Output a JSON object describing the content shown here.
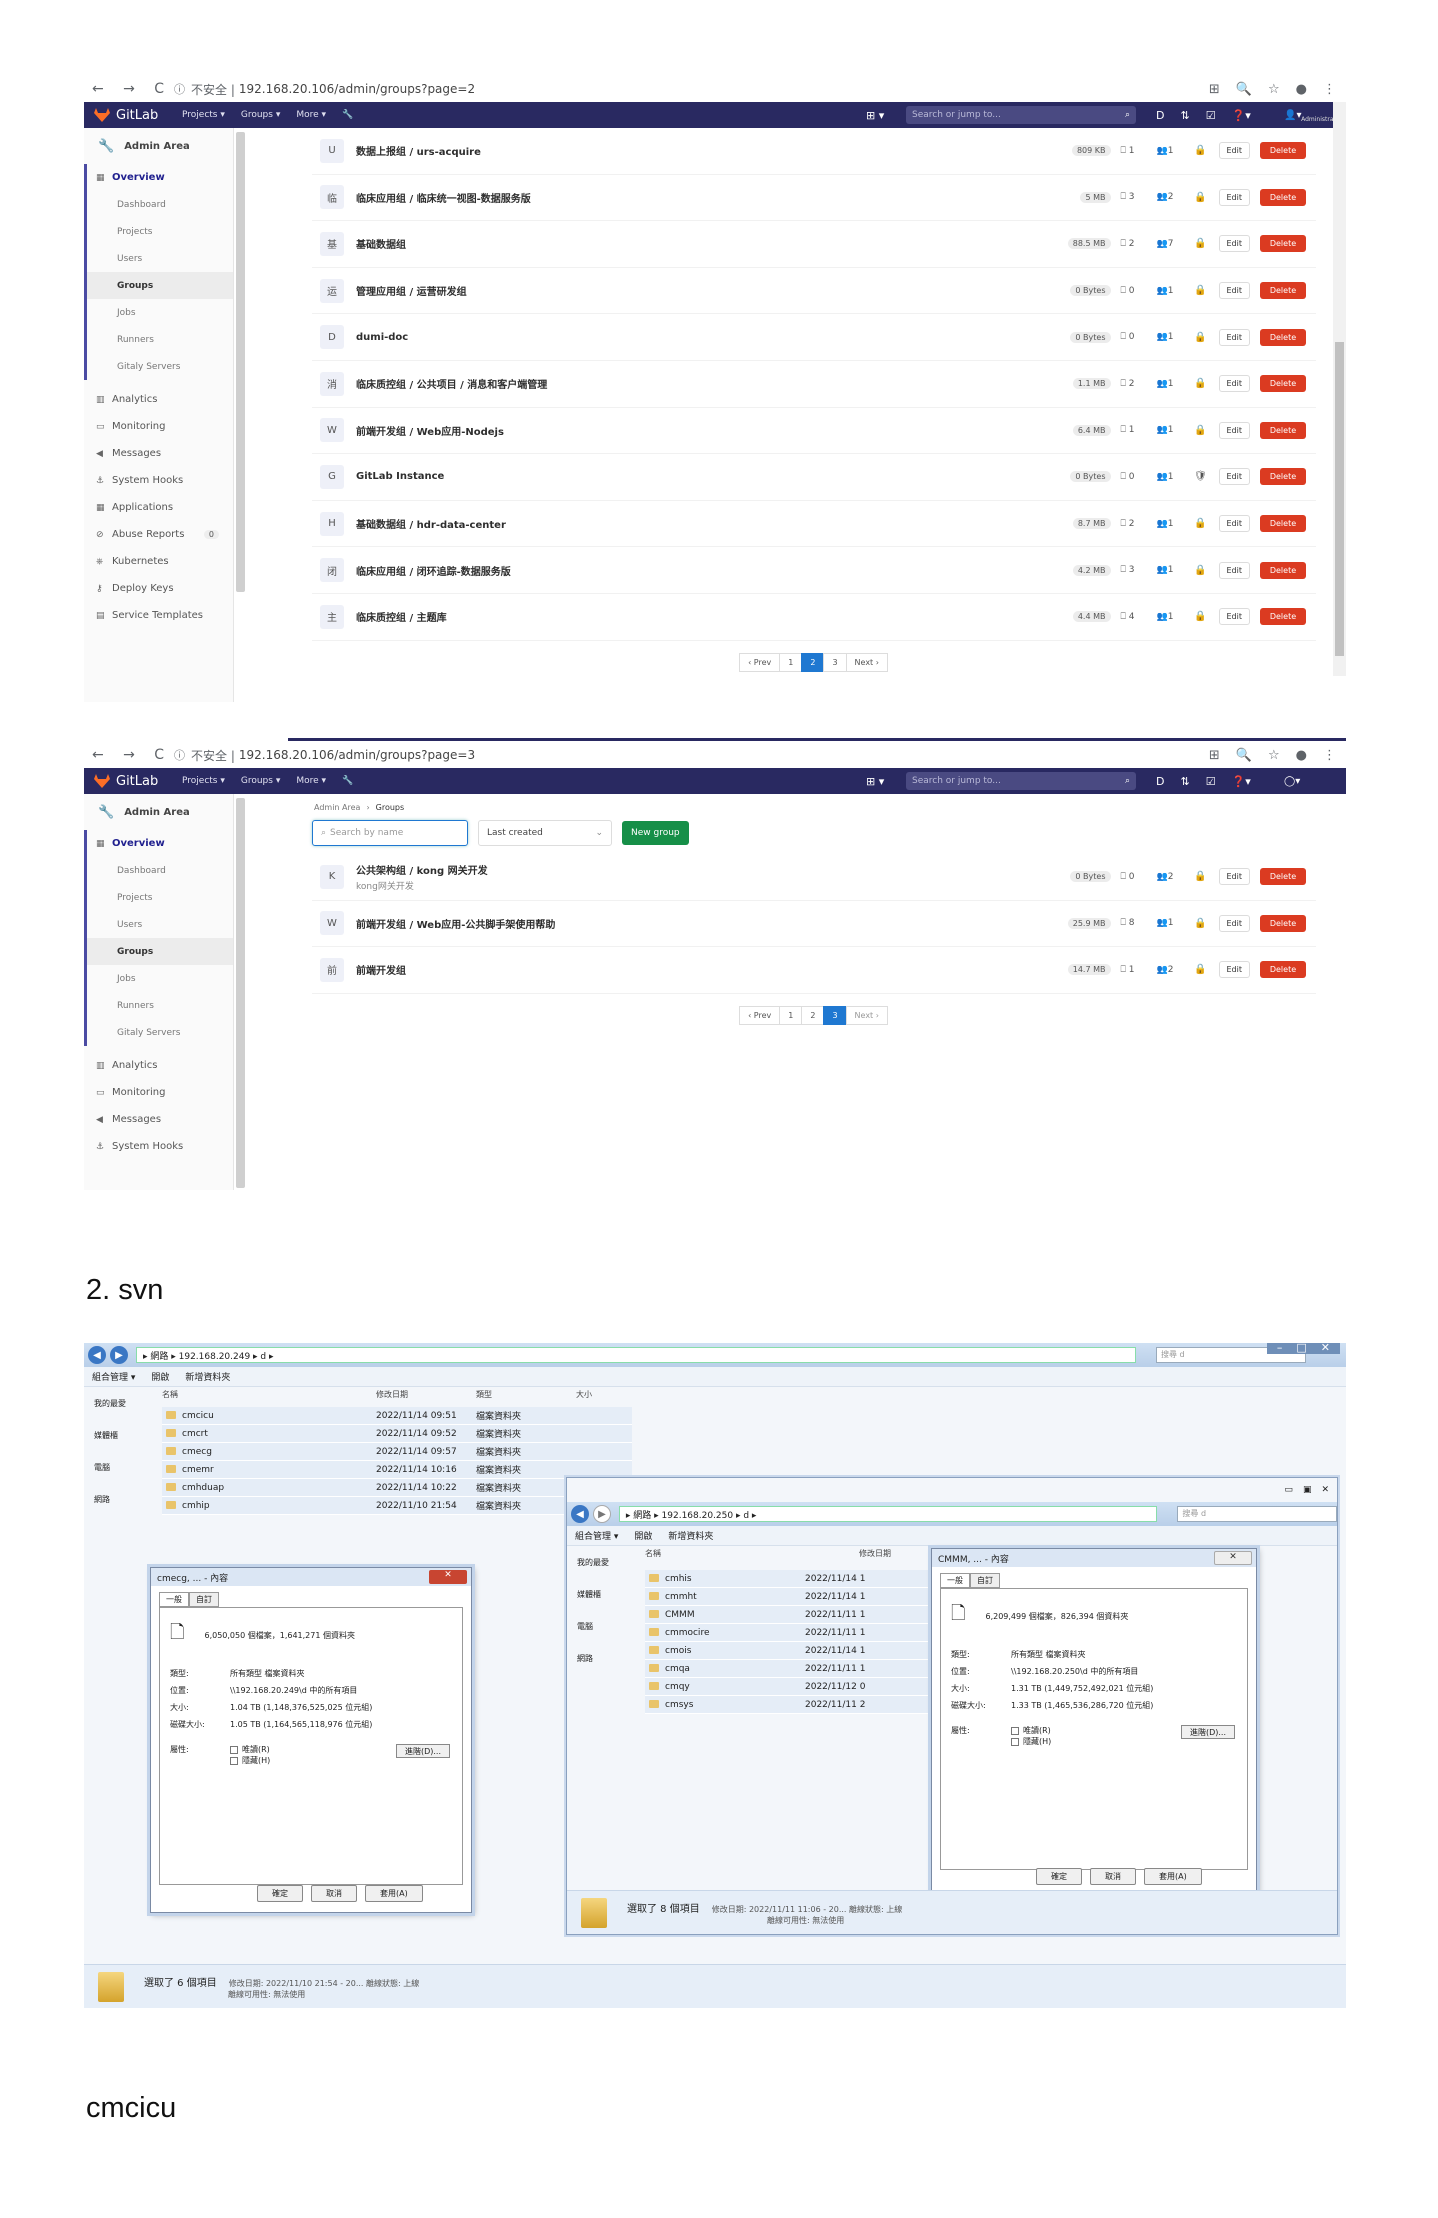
{
  "shot1": {
    "url_prefix": "不安全 | ",
    "url": "192.168.20.106/admin/groups?page=2",
    "topbar": {
      "brand": "GitLab",
      "nav": [
        "Projects ▾",
        "Groups ▾",
        "More ▾"
      ],
      "search_placeholder": "Search or jump to...",
      "user": "Administrator"
    },
    "sidebar": {
      "title": "Admin Area",
      "overview": "Overview",
      "sub": [
        "Dashboard",
        "Projects",
        "Users",
        "Groups",
        "Jobs",
        "Runners",
        "Gitaly Servers"
      ],
      "items": [
        "Analytics",
        "Monitoring",
        "Messages",
        "System Hooks",
        "Applications",
        "Abuse Reports",
        "Kubernetes",
        "Deploy Keys",
        "Service Templates"
      ],
      "abuse_count": "0"
    },
    "rows": [
      {
        "avatar": "U",
        "name": "数据上报组 / urs-acquire",
        "size": "809 KB",
        "projects": "1",
        "members": "1",
        "lock": "🔒"
      },
      {
        "avatar": "临",
        "name": "临床应用组 / 临床统一视图-数据服务版",
        "size": "5 MB",
        "projects": "3",
        "members": "2",
        "lock": "🔒"
      },
      {
        "avatar": "基",
        "name": "基础数据组",
        "size": "88.5 MB",
        "projects": "2",
        "members": "7",
        "lock": "🔒"
      },
      {
        "avatar": "运",
        "name": "管理应用组 / 运营研发组",
        "size": "0 Bytes",
        "projects": "0",
        "members": "1",
        "lock": "🔒"
      },
      {
        "avatar": "D",
        "name": "dumi-doc",
        "size": "0 Bytes",
        "projects": "0",
        "members": "1",
        "lock": "🔒"
      },
      {
        "avatar": "消",
        "name": "临床质控组 / 公共项目 / 消息和客户端管理",
        "size": "1.1 MB",
        "projects": "2",
        "members": "1",
        "lock": "🔒"
      },
      {
        "avatar": "W",
        "name": "前端开发组 / Web应用-Nodejs",
        "size": "6.4 MB",
        "projects": "1",
        "members": "1",
        "lock": "🔒"
      },
      {
        "avatar": "G",
        "name": "GitLab Instance",
        "size": "0 Bytes",
        "projects": "0",
        "members": "1",
        "lock": "🛡"
      },
      {
        "avatar": "H",
        "name": "基础数据组 / hdr-data-center",
        "size": "8.7 MB",
        "projects": "2",
        "members": "1",
        "lock": "🔒"
      },
      {
        "avatar": "闭",
        "name": "临床应用组 / 闭环追踪-数据服务版",
        "size": "4.2 MB",
        "projects": "3",
        "members": "1",
        "lock": "🔒"
      },
      {
        "avatar": "主",
        "name": "临床质控组 / 主题库",
        "size": "4.4 MB",
        "projects": "4",
        "members": "1",
        "lock": "🔒"
      }
    ],
    "edit_label": "Edit",
    "delete_label": "Delete",
    "pager": [
      "‹ Prev",
      "1",
      "2",
      "3",
      "Next ›"
    ],
    "current_page": "2"
  },
  "shot2": {
    "url_prefix": "不安全 | ",
    "url": "192.168.20.106/admin/groups?page=3",
    "breadcrumb": [
      "Admin Area",
      "Groups"
    ],
    "search_placeholder": "Search by name",
    "sort": "Last created",
    "new_group": "New group",
    "sidebar_items": [
      "Analytics",
      "Monitoring",
      "Messages",
      "System Hooks"
    ],
    "rows": [
      {
        "avatar": "K",
        "name": "公共架构组 / kong 网关开发",
        "desc": "kong网关开发",
        "size": "0 Bytes",
        "projects": "0",
        "members": "2",
        "lock": "🔒"
      },
      {
        "avatar": "W",
        "name": "前端开发组 / Web应用-公共脚手架使用帮助",
        "desc": "",
        "size": "25.9 MB",
        "projects": "8",
        "members": "1",
        "lock": "🔒"
      },
      {
        "avatar": "前",
        "name": "前端开发组",
        "desc": "",
        "size": "14.7 MB",
        "projects": "1",
        "members": "2",
        "lock": "🔒"
      }
    ],
    "pager": [
      "‹ Prev",
      "1",
      "2",
      "3",
      "Next ›"
    ],
    "current_page": "3"
  },
  "heading_svn": "2.   svn",
  "heading_cmcicu": "cmcicu",
  "explorer": {
    "path": "▸ 網路 ▸ 192.168.20.249 ▸ d ▸",
    "search": "搜尋 d",
    "toolbar": [
      "組合管理 ▾",
      "開啟",
      "新增資料夾"
    ],
    "nav": [
      "我的最愛",
      "媒體櫃",
      "電腦",
      "網路"
    ],
    "cols": [
      "名稱",
      "修改日期",
      "類型",
      "大小"
    ],
    "files": [
      {
        "name": "cmcicu",
        "date": "2022/11/14 09:51",
        "type": "檔案資料夾"
      },
      {
        "name": "cmcrt",
        "date": "2022/11/14 09:52",
        "type": "檔案資料夾"
      },
      {
        "name": "cmecg",
        "date": "2022/11/14 09:57",
        "type": "檔案資料夾"
      },
      {
        "name": "cmemr",
        "date": "2022/11/14 10:16",
        "type": "檔案資料夾"
      },
      {
        "name": "cmhduap",
        "date": "2022/11/14 10:22",
        "type": "檔案資料夾"
      },
      {
        "name": "cmhip",
        "date": "2022/11/10 21:54",
        "type": "檔案資料夾"
      }
    ],
    "status_main": "選取了 6 個項目",
    "status_sub1": "修改日期: 2022/11/10 21:54 - 20... 離線狀態: 上線",
    "status_sub2": "離線可用性: 無法使用",
    "dlg": {
      "title": "cmecg, ... - 內容",
      "tabs": [
        "一般",
        "自訂"
      ],
      "count": "6,050,050 個檔案，1,641,271 個資料夾",
      "kv": [
        [
          "類型:",
          "所有類型 檔案資料夾"
        ],
        [
          "位置:",
          "\\\\192.168.20.249\\d 中的所有項目"
        ],
        [
          "大小:",
          "1.04 TB (1,148,376,525,025 位元組)"
        ],
        [
          "磁碟大小:",
          "1.05 TB (1,164,565,118,976 位元組)"
        ]
      ],
      "attr": "屬性:",
      "readonly": "唯讀(R)",
      "hidden": "隱藏(H)",
      "adv": "進階(D)...",
      "buttons": [
        "確定",
        "取消",
        "套用(A)"
      ]
    }
  },
  "explorer2": {
    "path": "▸ 網路 ▸ 192.168.20.250 ▸ d ▸",
    "search": "搜尋 d",
    "toolbar": [
      "組合管理 ▾",
      "開啟",
      "新增資料夾"
    ],
    "nav": [
      "我的最愛",
      "媒體櫃",
      "電腦",
      "網路"
    ],
    "cols": [
      "名稱",
      "修改日期",
      "類型",
      "大小"
    ],
    "files": [
      {
        "name": "cmhis",
        "date": "2022/11/14 1"
      },
      {
        "name": "cmmht",
        "date": "2022/11/14 1"
      },
      {
        "name": "CMMM",
        "date": "2022/11/11 1"
      },
      {
        "name": "cmmocire",
        "date": "2022/11/11 1"
      },
      {
        "name": "cmois",
        "date": "2022/11/14 1"
      },
      {
        "name": "cmqa",
        "date": "2022/11/11 1"
      },
      {
        "name": "cmqy",
        "date": "2022/11/12 0"
      },
      {
        "name": "cmsys",
        "date": "2022/11/11 2"
      }
    ],
    "status_main": "選取了 8 個項目",
    "status_sub1": "修改日期: 2022/11/11 11:06 - 20... 離線狀態: 上線",
    "status_sub2": "離線可用性: 無法使用",
    "dlg": {
      "title": "CMMM, ... - 內容",
      "tabs": [
        "一般",
        "自訂"
      ],
      "count": "6,209,499 個檔案，826,394 個資料夾",
      "kv": [
        [
          "類型:",
          "所有類型 檔案資料夾"
        ],
        [
          "位置:",
          "\\\\192.168.20.250\\d 中的所有項目"
        ],
        [
          "大小:",
          "1.31 TB (1,449,752,492,021 位元組)"
        ],
        [
          "磁碟大小:",
          "1.33 TB (1,465,536,286,720 位元組)"
        ]
      ],
      "attr": "屬性:",
      "readonly": "唯讀(R)",
      "hidden": "隱藏(H)",
      "adv": "進階(D)...",
      "buttons": [
        "確定",
        "取消",
        "套用(A)"
      ]
    }
  }
}
